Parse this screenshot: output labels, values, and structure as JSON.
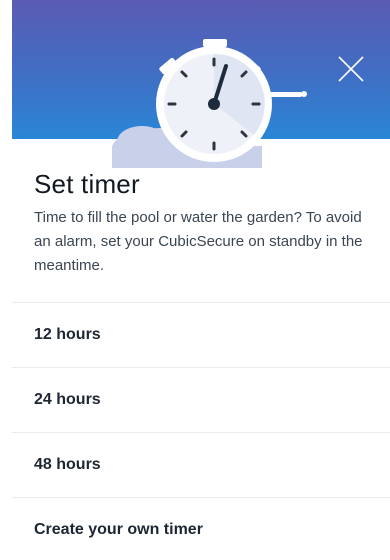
{
  "dialog": {
    "title": "Set timer",
    "description": "Time to fill the pool or water the garden? To avoid an alarm, set your CubicSecure on standby in the meantime."
  },
  "close_icon": "close-icon",
  "hero_icon": "stopwatch-icon",
  "options": [
    {
      "label": "12 hours"
    },
    {
      "label": "24 hours"
    },
    {
      "label": "48 hours"
    },
    {
      "label": "Create your own timer"
    }
  ],
  "colors": {
    "header_gradient_top": "#5b5bb3",
    "header_gradient_bottom": "#2a86d6",
    "text_primary": "#111a22",
    "divider": "#e7eaee"
  }
}
